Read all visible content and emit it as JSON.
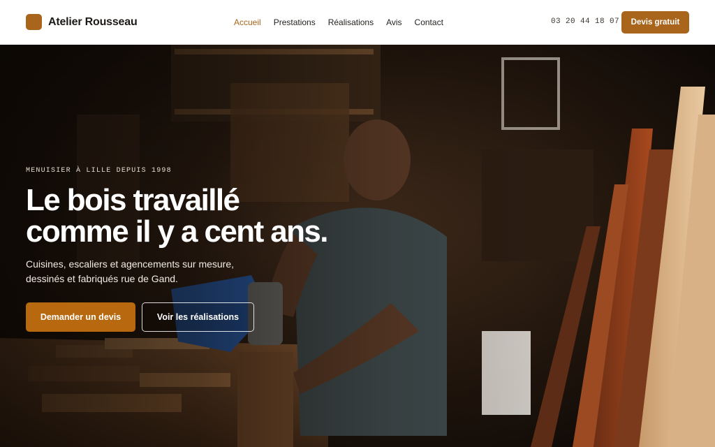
{
  "brand": {
    "name": "Atelier Rousseau",
    "logo_icon": "square-logo-icon",
    "accent": "#a8651b"
  },
  "nav": {
    "items": [
      {
        "label": "Accueil",
        "active": true
      },
      {
        "label": "Prestations",
        "active": false
      },
      {
        "label": "Réalisations",
        "active": false
      },
      {
        "label": "Avis",
        "active": false
      },
      {
        "label": "Contact",
        "active": false
      }
    ]
  },
  "header": {
    "phone": "03 20 44 18 07",
    "cta_label": "Devis gratuit"
  },
  "hero": {
    "eyebrow": "MENUISIER À LILLE DEPUIS 1998",
    "headline": [
      "Le bois travaillé",
      "comme il y a cent ans."
    ],
    "subtitle": [
      "Cuisines, escaliers et agencements sur mesure,",
      "dessinés et fabriqués rue de Gand."
    ],
    "primary_cta": "Demander un devis",
    "secondary_cta": "Voir les réalisations",
    "primary_color": "#b8690f"
  }
}
